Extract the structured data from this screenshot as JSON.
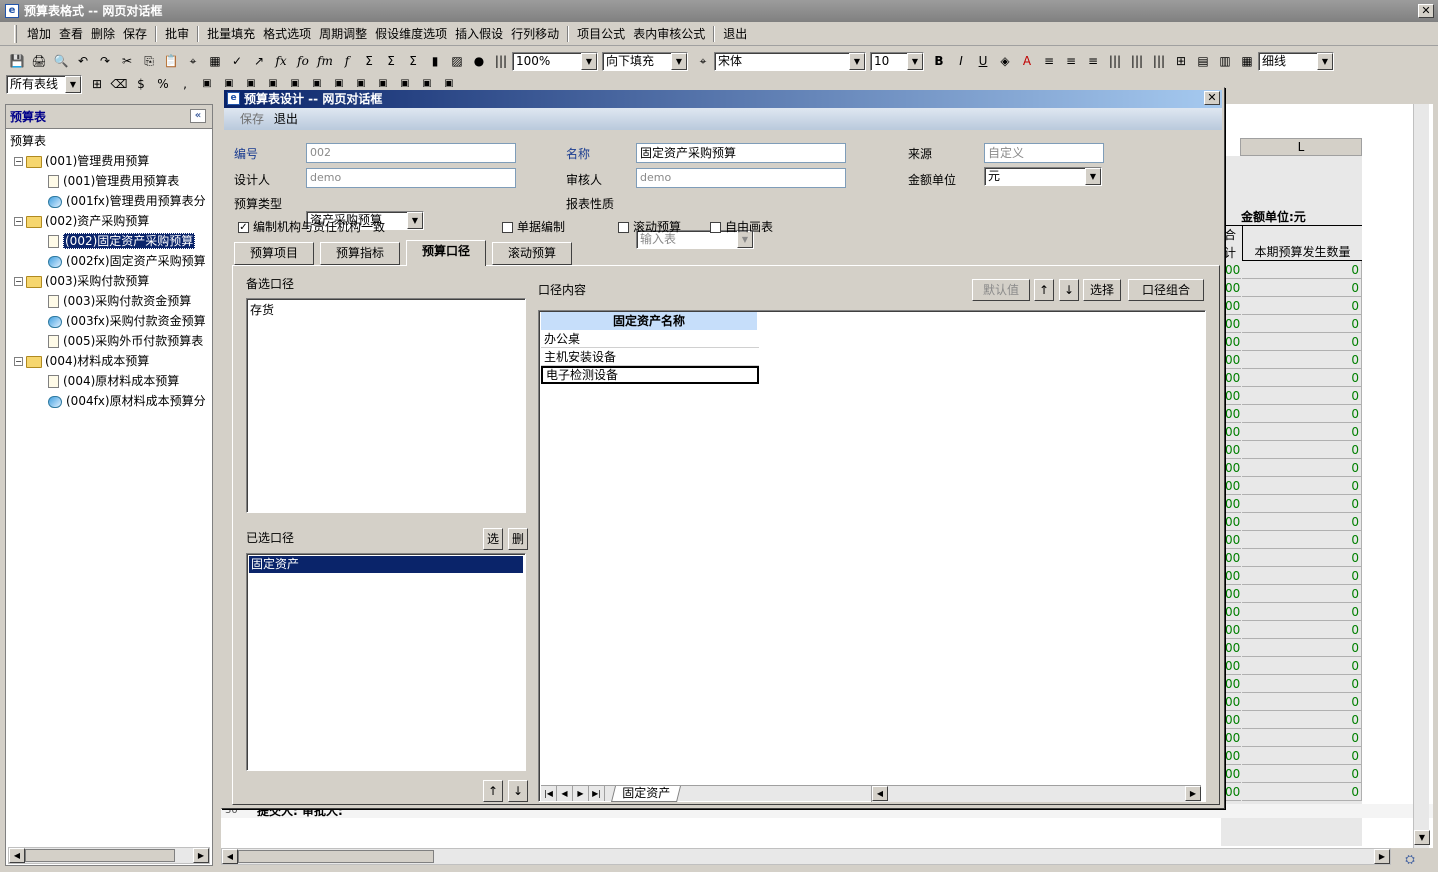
{
  "window": {
    "title": "预算表格式 -- 网页对话框",
    "close": "✕"
  },
  "menu": [
    "增加",
    "查看",
    "删除",
    "保存",
    "|",
    "批审",
    "|",
    "批量填充",
    "格式选项",
    "周期调整",
    "假设维度选项",
    "插入假设",
    "行列移动",
    "|",
    "项目公式",
    "表内审核公式",
    "|",
    "退出"
  ],
  "toolbar": {
    "zoom": "100%",
    "fill": "向下填充",
    "font": "宋体",
    "size": "10",
    "line": "细线",
    "sheets": "所有表线",
    "icons": [
      "save-icon",
      "print-icon",
      "preview-icon",
      "undo-icon",
      "redo-icon",
      "cut-icon",
      "copy-icon",
      "paste-icon",
      "find-icon",
      "grid-icon",
      "brush-icon",
      "export-icon",
      "fx-icon",
      "fo-icon",
      "fm-icon",
      "fa-icon",
      "sum-icon",
      "sum2-icon",
      "sum3-icon",
      "chart-icon",
      "image-icon",
      "globe-icon",
      "barcode-icon"
    ],
    "row2_icons": [
      "border-icon",
      "eraser-icon",
      "format-icon",
      "percent-icon",
      "comma-icon"
    ],
    "glyphs": [
      "💾",
      "🖨",
      "🔍",
      "↶",
      "↷",
      "✂",
      "⎘",
      "📋",
      "⌖",
      "▦",
      "✓",
      "↗",
      "fx",
      "fo",
      "fm",
      "f",
      "Σ",
      "Σ",
      "Σ",
      "▮",
      "▨",
      "●",
      "|||"
    ],
    "row2_glyphs": [
      "⊞",
      "⌫",
      "$",
      "%",
      ","
    ]
  },
  "left_panel": {
    "title": "预算表",
    "collapse": "«",
    "tree": [
      {
        "level": 0,
        "type": "root",
        "label": "预算表"
      },
      {
        "level": 1,
        "type": "folder",
        "label": "(001)管理费用预算",
        "exp": "−"
      },
      {
        "level": 2,
        "type": "doc",
        "label": "(001)管理费用预算表"
      },
      {
        "level": 2,
        "type": "chart",
        "label": "(001fx)管理费用预算表分"
      },
      {
        "level": 1,
        "type": "folder",
        "label": "(002)资产采购预算",
        "exp": "−"
      },
      {
        "level": 2,
        "type": "doc",
        "label": "(002)固定资产采购预算",
        "selected": true
      },
      {
        "level": 2,
        "type": "chart",
        "label": "(002fx)固定资产采购预算"
      },
      {
        "level": 1,
        "type": "folder",
        "label": "(003)采购付款预算",
        "exp": "−"
      },
      {
        "level": 2,
        "type": "doc",
        "label": "(003)采购付款资金预算"
      },
      {
        "level": 2,
        "type": "chart",
        "label": "(003fx)采购付款资金预算"
      },
      {
        "level": 2,
        "type": "doc",
        "label": "(005)采购外币付款预算表"
      },
      {
        "level": 1,
        "type": "folder",
        "label": "(004)材料成本预算",
        "exp": "−"
      },
      {
        "level": 2,
        "type": "doc",
        "label": "(004)原材料成本预算"
      },
      {
        "level": 2,
        "type": "chart",
        "label": "(004fx)原材料成本预算分"
      }
    ]
  },
  "background_sheet": {
    "col_label": "L",
    "amount_unit": "金额单位:元",
    "header_left": "合计",
    "header_right": "本期预算发生数量",
    "zero": "0",
    "left_zero": "00",
    "rows": 30,
    "footer": "提交人:    审批人:",
    "footer_row": "30"
  },
  "dialog": {
    "title": "预算表设计 -- 网页对话框",
    "close": "✕",
    "save": "保存",
    "exit": "退出",
    "fields": {
      "code_label": "编号",
      "code": "002",
      "name_label": "名称",
      "name": "固定资产采购预算",
      "source_label": "来源",
      "source": "自定义",
      "designer_label": "设计人",
      "designer": "demo",
      "reviewer_label": "审核人",
      "reviewer": "demo",
      "unit_label": "金额单位",
      "unit": "元",
      "type_label": "预算类型",
      "type": "资产采购预算",
      "nature_label": "报表性质",
      "nature": "输入表"
    },
    "checks": {
      "org_consistent": "编制机构与责任机构一致",
      "single": "单据编制",
      "rolling": "滚动预算",
      "free_draw": "自由画表",
      "check_mark": "✓"
    },
    "tabs": [
      "预算项目",
      "预算指标",
      "预算口径",
      "滚动预算"
    ],
    "active_tab": "预算口径",
    "caliber": {
      "available_label": "备选口径",
      "available": [
        "存货"
      ],
      "selected_label": "已选口径",
      "selected": [
        "固定资产"
      ],
      "select_btn": "选",
      "delete_btn": "删",
      "up": "↑",
      "down": "↓",
      "content_label": "口径内容",
      "default_btn": "默认值",
      "choose_btn": "选择",
      "combo_btn": "口径组合",
      "column_header": "固定资产名称",
      "rows": [
        "办公桌",
        "主机安装设备",
        "电子检测设备"
      ],
      "sheet_tab": "固定资产",
      "nav": [
        "|◀",
        "◀",
        "▶",
        "▶|"
      ]
    }
  },
  "colors": {
    "selection": "#0a246a",
    "title_gradient_start": "#0a246a",
    "zero_text": "#008000"
  }
}
